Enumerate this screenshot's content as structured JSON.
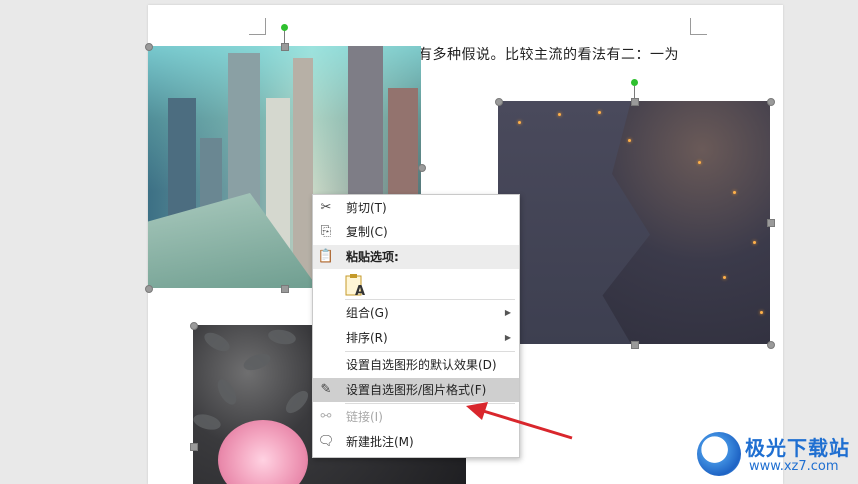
{
  "document": {
    "body_text": "有多种假说。比较主流的看法有二：一为"
  },
  "context_menu": {
    "items": [
      {
        "label": "剪切(T)",
        "icon": "scissors-icon"
      },
      {
        "label": "复制(C)",
        "icon": "copy-icon"
      },
      {
        "label": "粘贴选项:",
        "icon": "paste-icon"
      },
      {
        "label": "组合(G)",
        "icon": "",
        "submenu": true
      },
      {
        "label": "排序(R)",
        "icon": "",
        "submenu": true
      },
      {
        "label": "设置自选图形的默认效果(D)",
        "icon": ""
      },
      {
        "label": "设置自选图形/图片格式(F)",
        "icon": "format-shape-icon",
        "highlighted": true
      },
      {
        "label": "链接(I)",
        "icon": "link-icon",
        "disabled": true
      },
      {
        "label": "新建批注(M)",
        "icon": "new-comment-icon"
      }
    ],
    "paste_keep_text_glyph": "A"
  },
  "watermark": {
    "name": "极光下载站",
    "url": "www.xz7.com"
  },
  "colors": {
    "rotation_handle": "#2ec02e",
    "arrow": "#d9262c",
    "watermark": "#1f6fd1"
  }
}
